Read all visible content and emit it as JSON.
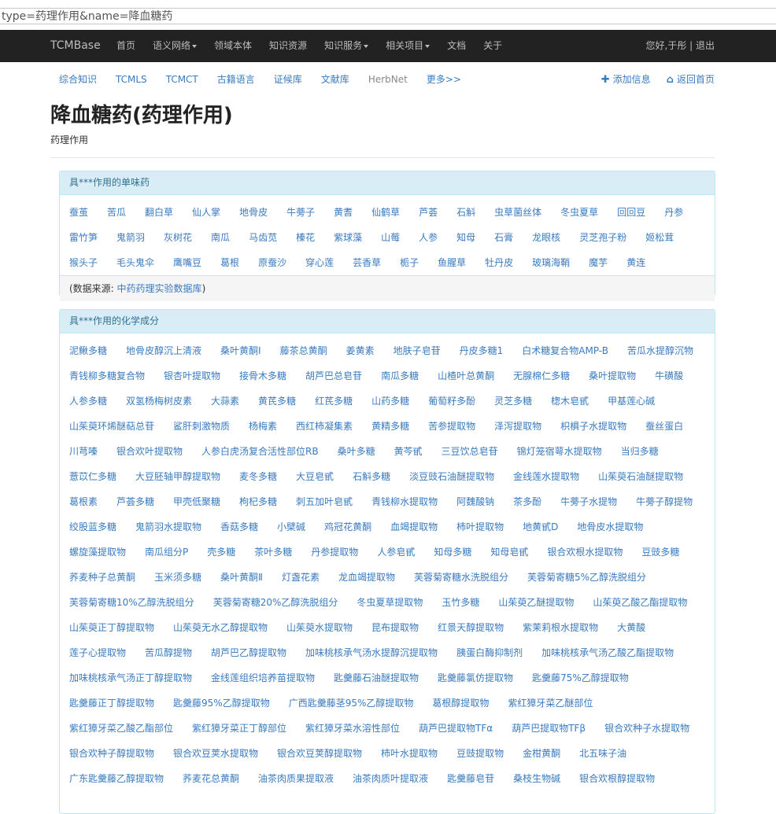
{
  "browser": {
    "url": "type=药理作用&name=降血糖药"
  },
  "navbar": {
    "brand": "TCMBase",
    "items": [
      "首页",
      "语义网络",
      "领域本体",
      "知识资源",
      "知识服务",
      "相关项目",
      "文档",
      "关于"
    ],
    "dropdown_flags": [
      false,
      true,
      false,
      false,
      true,
      true,
      false,
      false
    ],
    "user": "您好,于彤 | 退出"
  },
  "subnav": {
    "items": [
      "综合知识",
      "TCMLS",
      "TCMCT",
      "古籍语言",
      "证候库",
      "文献库",
      "HerbNet",
      "更多>>"
    ],
    "add_info": "添加信息",
    "back_home": "返回首页"
  },
  "page": {
    "title": "降血糖药(药理作用)",
    "subtitle": "药理作用"
  },
  "herbs_panel": {
    "heading": "具***作用的单味药",
    "items": [
      "蚕茧",
      "苦瓜",
      "翻白草",
      "仙人掌",
      "地骨皮",
      "牛蒡子",
      "黄耆",
      "仙鹤草",
      "芦荟",
      "石斛",
      "虫草菌丝体",
      "冬虫夏草",
      "回回豆",
      "丹参",
      "雷竹笋",
      "鬼箭羽",
      "灰树花",
      "南瓜",
      "马齿苋",
      "榛花",
      "紫球藻",
      "山莓",
      "人参",
      "知母",
      "石膏",
      "龙眼核",
      "灵芝孢子粉",
      "姬松茸",
      "猴头子",
      "毛头鬼伞",
      "鹰嘴豆",
      "葛根",
      "原蚕沙",
      "穿心莲",
      "芸香草",
      "栀子",
      "鱼腥草",
      "牡丹皮",
      "玻璃海鞘",
      "魔芋",
      "黄连"
    ],
    "source_label": "(数据来源: ",
    "source_link": "中药药理实验数据库",
    "source_end": ")"
  },
  "compounds_panel": {
    "heading": "具***作用的化学成分",
    "items": [
      "泥鳅多糖",
      "地骨皮醇沉上清液",
      "桑叶黄酮Ⅰ",
      "藤茶总黄酮",
      "姜黄素",
      "地肤子皂苷",
      "丹皮多糖1",
      "白术糖复合物AMP-B",
      "苦瓜水提醇沉物",
      "青钱柳多糖复合物",
      "银杏叶提取物",
      "接骨木多糖",
      "胡芦巴总皂苷",
      "南瓜多糖",
      "山楂叶总黄酮",
      "无腺棉仁多糖",
      "桑叶提取物",
      "牛磺酸",
      "人参多糖",
      "双氢杨梅树皮素",
      "大蒜素",
      "黄芪多糖",
      "红芪多糖",
      "山药多糖",
      "葡萄籽多酚",
      "灵芝多糖",
      "楤木皂甙",
      "甲基莲心碱",
      "山茱萸环烯醚萜总苷",
      "鲨肝刺激物质",
      "杨梅素",
      "西红柿凝集素",
      "黄精多糖",
      "苦参提取物",
      "泽泻提取物",
      "枳椇子水提取物",
      "蚕丝蛋白",
      "川芎嗪",
      "银合欢叶提取物",
      "人参白虎汤复合活性部位RB",
      "桑叶多糖",
      "黄芩甙",
      "三豆饮总皂苷",
      "锦灯笼宿萼水提取物",
      "当归多糖",
      "薏苡仁多糖",
      "大豆胚轴甲醇提取物",
      "麦冬多糖",
      "大豆皂甙",
      "石斛多糖",
      "淡豆豉石油醚提取物",
      "金线莲水提取物",
      "山茱萸石油醚提取物",
      "葛根素",
      "芦荟多糖",
      "甲壳低聚糖",
      "枸杞多糖",
      "刺五加叶皂甙",
      "青钱柳水提取物",
      "阿魏酸钠",
      "茶多酚",
      "牛蒡子水提物",
      "牛蒡子醇提物",
      "绞股蓝多糖",
      "鬼箭羽水提取物",
      "香菇多糖",
      "小檗碱",
      "鸡冠花黄酮",
      "血竭提取物",
      "柿叶提取物",
      "地黄甙D",
      "地骨皮水提取物",
      "螺旋藻提取物",
      "南瓜组分P",
      "壳多糖",
      "茶叶多糖",
      "丹参提取物",
      "人参皂甙",
      "知母多糖",
      "知母皂甙",
      "银合欢根水提取物",
      "豆豉多糖",
      "荞麦种子总黄酮",
      "玉米须多糖",
      "桑叶黄酮Ⅱ",
      "灯盏花素",
      "龙血竭提取物",
      "芙蓉菊寄糖水洗脱组分",
      "芙蓉菊寄糖5%乙醇洗脱组分",
      "芙蓉菊寄糖10%乙醇洗脱组分",
      "芙蓉菊寄糖20%乙醇洗脱组分",
      "冬虫夏草提取物",
      "玉竹多糖",
      "山茱萸乙醚提取物",
      "山茱萸乙酸乙酯提取物",
      "山茱萸正丁醇提取物",
      "山茱萸无水乙醇提取物",
      "山茱萸水提取物",
      "昆布提取物",
      "红景天醇提取物",
      "紫茉莉根水提取物",
      "大黄酸",
      "莲子心提取物",
      "苦瓜醇提物",
      "胡芦巴乙醇提取物",
      "加味桃核承气汤水提醇沉提取物",
      "胰蛋白酶抑制剂",
      "加味桃核承气汤乙酸乙酯提取物",
      "加味桃核承气汤正丁醇提取物",
      "金线莲组织培养苗提取物",
      "匙羹藤石油醚提取物",
      "匙羹藤氯仿提取物",
      "匙羹藤75%乙醇提取物",
      "匙羹藤正丁醇提取物",
      "匙羹藤95%乙醇提取物",
      "广西匙羹藤茎95%乙醇提取物",
      "葛根醇提取物",
      "紫红獐牙菜乙醚部位",
      "紫红獐牙菜乙酸乙酯部位",
      "紫红獐牙菜正丁醇部位",
      "紫红獐牙菜水溶性部位",
      "葫芦巴提取物TFα",
      "葫芦巴提取物TFβ",
      "银合欢种子水提取物",
      "银合欢种子醇提取物",
      "银合欢豆荚水提取物",
      "银合欢豆荚醇提取物",
      "柿叶水提取物",
      "豆豉提取物",
      "金柑黄酮",
      "北五味子油",
      "广东匙羹藤乙醇提取物",
      "荞麦花总黄酮",
      "油茶肉质果提取液",
      "油茶肉质叶提取液",
      "匙羹藤皂苷",
      "桑枝生物碱",
      "银合欢根醇提取物"
    ]
  }
}
